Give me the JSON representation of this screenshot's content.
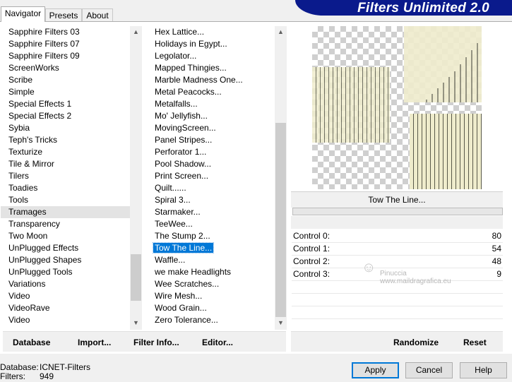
{
  "tabs": [
    "Navigator",
    "Presets",
    "About"
  ],
  "app_title": "Filters Unlimited 2.0",
  "categories": {
    "items": [
      "Sapphire Filters 03",
      "Sapphire Filters 07",
      "Sapphire Filters 09",
      "ScreenWorks",
      "Scribe",
      "Simple",
      "Special Effects 1",
      "Special Effects 2",
      "Sybia",
      "Teph's Tricks",
      "Texturize",
      "Tile & Mirror",
      "Tilers",
      "Toadies",
      "Tools",
      "Tramages",
      "Transparency",
      "Two Moon",
      "UnPlugged Effects",
      "UnPlugged Shapes",
      "UnPlugged Tools",
      "Variations",
      "Video",
      "VideoRave",
      "Video"
    ],
    "selected": "Tramages"
  },
  "filters": {
    "items": [
      "Hex Lattice...",
      "Holidays in Egypt...",
      "Legolator...",
      "Mapped Thingies...",
      "Marble Madness One...",
      "Metal Peacocks...",
      "Metalfalls...",
      "Mo' Jellyfish...",
      "MovingScreen...",
      "Panel Stripes...",
      "Perforator 1...",
      "Pool Shadow...",
      "Print Screen...",
      "Quilt......",
      "Spiral 3...",
      "Starmaker...",
      "TeeWee...",
      "The Stump 2...",
      "Tow The Line...",
      "Waffle...",
      "we make Headlights",
      "Wee Scratches...",
      "Wire Mesh...",
      "Wood Grain...",
      "Zero Tolerance..."
    ],
    "selected": "Tow The Line..."
  },
  "filter_name": "Tow The Line...",
  "controls": [
    {
      "label": "Control 0:",
      "value": "80"
    },
    {
      "label": "Control 1:",
      "value": "54"
    },
    {
      "label": "Control 2:",
      "value": "48"
    },
    {
      "label": "Control 3:",
      "value": "9"
    }
  ],
  "watermark": {
    "name": "Pinuccia",
    "url": "www.maildragrafica.eu"
  },
  "bottom_buttons": {
    "database": "Database",
    "import": "Import...",
    "filter_info": "Filter Info...",
    "editor": "Editor...",
    "randomize": "Randomize",
    "reset": "Reset"
  },
  "status": {
    "database_label": "Database:",
    "database_value": "ICNET-Filters",
    "filters_label": "Filters:",
    "filters_value": "949"
  },
  "dialog_buttons": {
    "apply": "Apply",
    "cancel": "Cancel",
    "help": "Help"
  },
  "colors": {
    "title_bar": "#0a1a8c",
    "selection": "#0078d7"
  }
}
